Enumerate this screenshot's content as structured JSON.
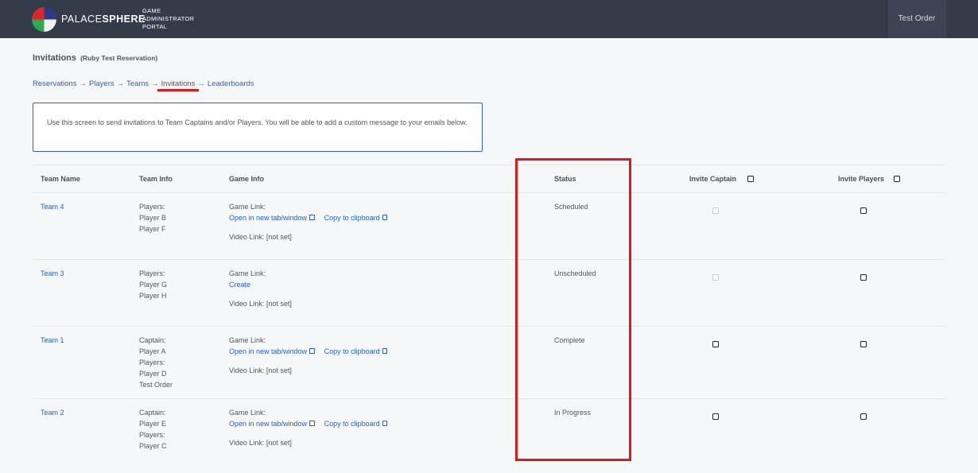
{
  "header": {
    "brand_light": "PALACE",
    "brand_bold": "SPHERE",
    "portal_lines": [
      "GAME",
      "ADMINISTRATOR",
      "PORTAL"
    ],
    "order_label": "Test Order"
  },
  "page": {
    "title": "Invitations",
    "subtitle": "(Ruby Test Reservation)"
  },
  "breadcrumb": [
    {
      "label": "Reservations",
      "current": false
    },
    {
      "label": "Players",
      "current": false
    },
    {
      "label": "Teams",
      "current": false
    },
    {
      "label": "Invitations",
      "current": true
    },
    {
      "label": "Leaderboards",
      "current": false
    }
  ],
  "breadcrumb_sep": "→",
  "notice": "Use this screen to send invitations to Team Captains and/or Players. You will be able to add a custom message to your emails below.",
  "table": {
    "headers": {
      "team_name": "Team Name",
      "team_info": "Team Info",
      "game_info": "Game Info",
      "status": "Status",
      "invite_captain": "Invite Captain",
      "invite_players": "Invite Players"
    },
    "game_link_label": "Game Link:",
    "open_label": "Open in new tab/window",
    "copy_label": "Copy to clipboard",
    "create_label": "Create",
    "video_label": "Video Link: [not set]",
    "rows": [
      {
        "team": "Team 4",
        "info": [
          "Players:",
          "Player B",
          "Player F"
        ],
        "has_link": true,
        "status": "Scheduled",
        "captain_enabled": false
      },
      {
        "team": "Team 3",
        "info": [
          "Players:",
          "Player G",
          "Player H"
        ],
        "has_link": false,
        "status": "Unscheduled",
        "captain_enabled": false
      },
      {
        "team": "Team 1",
        "info": [
          "Captain:",
          "Player A",
          "Players:",
          "Player D",
          "Test Order"
        ],
        "has_link": true,
        "status": "Complete",
        "captain_enabled": true
      },
      {
        "team": "Team 2",
        "info": [
          "Captain:",
          "Player E",
          "Players:",
          "Player C"
        ],
        "has_link": true,
        "status": "In Progress",
        "captain_enabled": true
      }
    ]
  },
  "colors": {
    "header_bg": "#333d4a",
    "link": "#1f62d6",
    "highlight": "#e01818"
  }
}
